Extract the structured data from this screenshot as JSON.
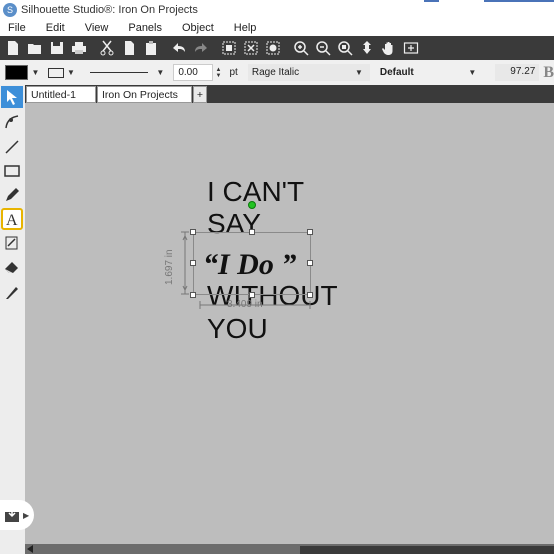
{
  "window": {
    "title": "Silhouette Studio®: Iron On Projects"
  },
  "menu": [
    "File",
    "Edit",
    "View",
    "Panels",
    "Object",
    "Help"
  ],
  "properties": {
    "fill_color": "#000000",
    "line_width_value": "0.00",
    "line_width_unit": "pt",
    "font_name": "Rage Italic",
    "font_style": "Default",
    "font_size": "97.27",
    "bold_label": "B"
  },
  "tabs": [
    {
      "label": "Untitled-1"
    },
    {
      "label": "Iron On Projects"
    },
    {
      "label": "+"
    }
  ],
  "design_text": {
    "line1": "I CAN'T",
    "line2": "SAY",
    "script_line": "“I Do ”",
    "line4": "WITHOUT",
    "line5": "YOU"
  },
  "dimensions": {
    "height_label": "1.697 in",
    "width_label": "3.409 in"
  },
  "icons": {
    "toolbar": [
      "new-file-icon",
      "open-icon",
      "save-icon",
      "print-icon",
      "cut-icon",
      "copy-icon",
      "paste-icon",
      "undo-icon",
      "redo-icon",
      "group-icon",
      "ungroup-icon",
      "compound-icon",
      "zoom-in-icon",
      "zoom-out-icon",
      "zoom-selection-icon",
      "move-icon",
      "pan-icon",
      "fit-page-icon"
    ],
    "left": [
      "pointer-icon",
      "edit-points-icon",
      "line-icon",
      "rectangle-icon",
      "pencil-icon",
      "text-icon",
      "eraser-panel-icon",
      "eraser-icon",
      "knife-icon",
      "library-icon"
    ]
  },
  "colors": {
    "toolbar_bg": "#3a3a3a",
    "selection_accent": "#3d8fd9",
    "rotation_handle": "#22c222",
    "text_tool_highlight": "#e8b400"
  }
}
